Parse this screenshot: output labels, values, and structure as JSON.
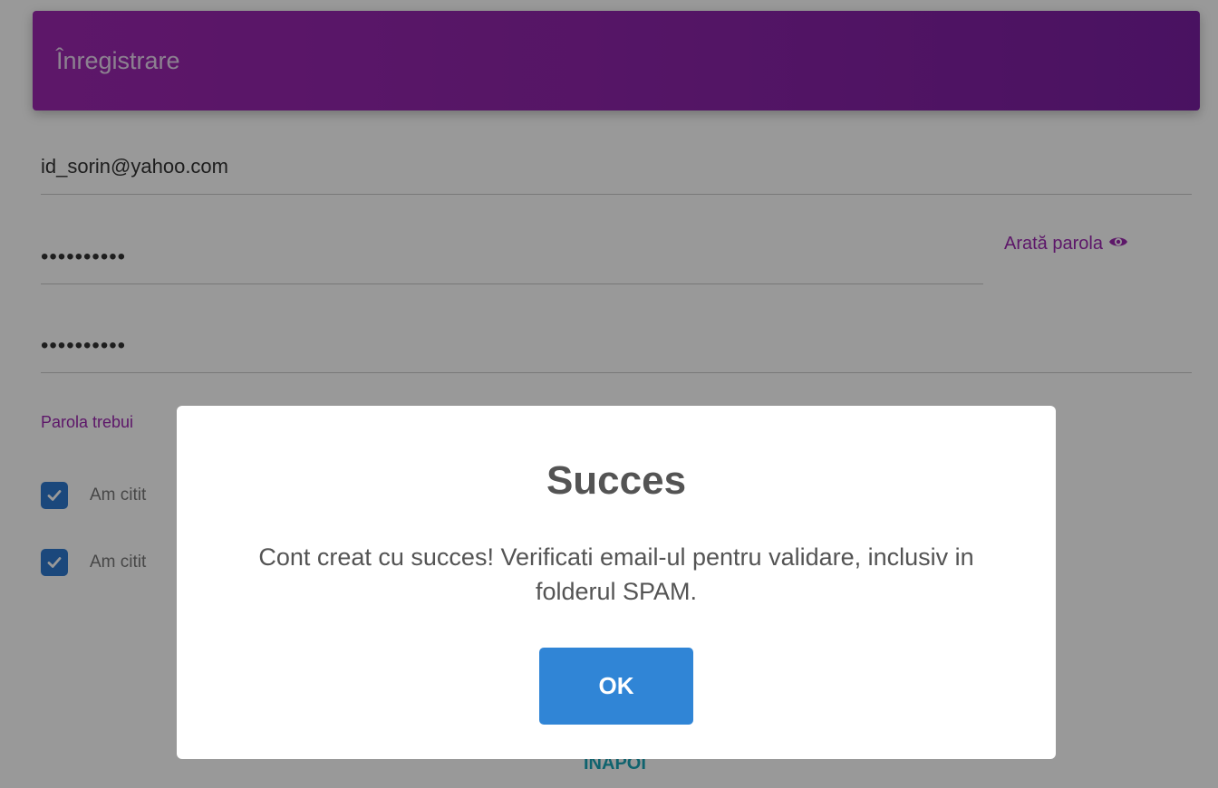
{
  "form": {
    "title": "Înregistrare",
    "email_value": "id_sorin@yahoo.com",
    "password_value": "••••••••••",
    "confirm_value": "••••••••••",
    "show_password_label": "Arată parola",
    "password_hint": "Parola trebui",
    "checkbox_1_label": "Am citit",
    "checkbox_2_label": "Am citit",
    "back_label": "ÎNAPOI"
  },
  "dialog": {
    "title": "Succes",
    "message": "Cont creat cu succes! Verificati email-ul pentru validare, inclusiv in folderul SPAM.",
    "ok_label": "OK"
  },
  "colors": {
    "header": "#9c27b0",
    "accent": "#9c27b0",
    "checkbox": "#2d79cf",
    "ok_button": "#3085d6",
    "back_link": "#1aa6b7"
  },
  "icons": {
    "show_password": "eye-icon",
    "checkbox": "check-icon"
  }
}
